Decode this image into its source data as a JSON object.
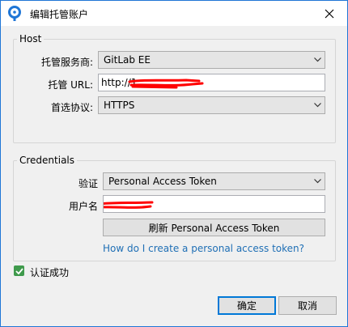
{
  "window": {
    "title": "编辑托管账户"
  },
  "host": {
    "legend": "Host",
    "service_label": "托管服务商:",
    "service_value": "GitLab EE",
    "url_label": "托管 URL:",
    "url_value": "http://1",
    "protocol_label": "首选协议:",
    "protocol_value": "HTTPS"
  },
  "credentials": {
    "legend": "Credentials",
    "auth_label": "验证",
    "auth_value": "Personal Access Token",
    "username_label": "用户名",
    "refresh_button": "刷新 Personal Access Token",
    "help_link": "How do I create a personal access token?"
  },
  "status": {
    "checkbox_label": "认证成功",
    "checked": true
  },
  "footer": {
    "ok_label": "确定",
    "cancel_label": "取消"
  },
  "colors": {
    "accent": "#0078d7",
    "link": "#1f6fb5",
    "check": "#3f9a4c",
    "redaction": "#ff0000"
  }
}
